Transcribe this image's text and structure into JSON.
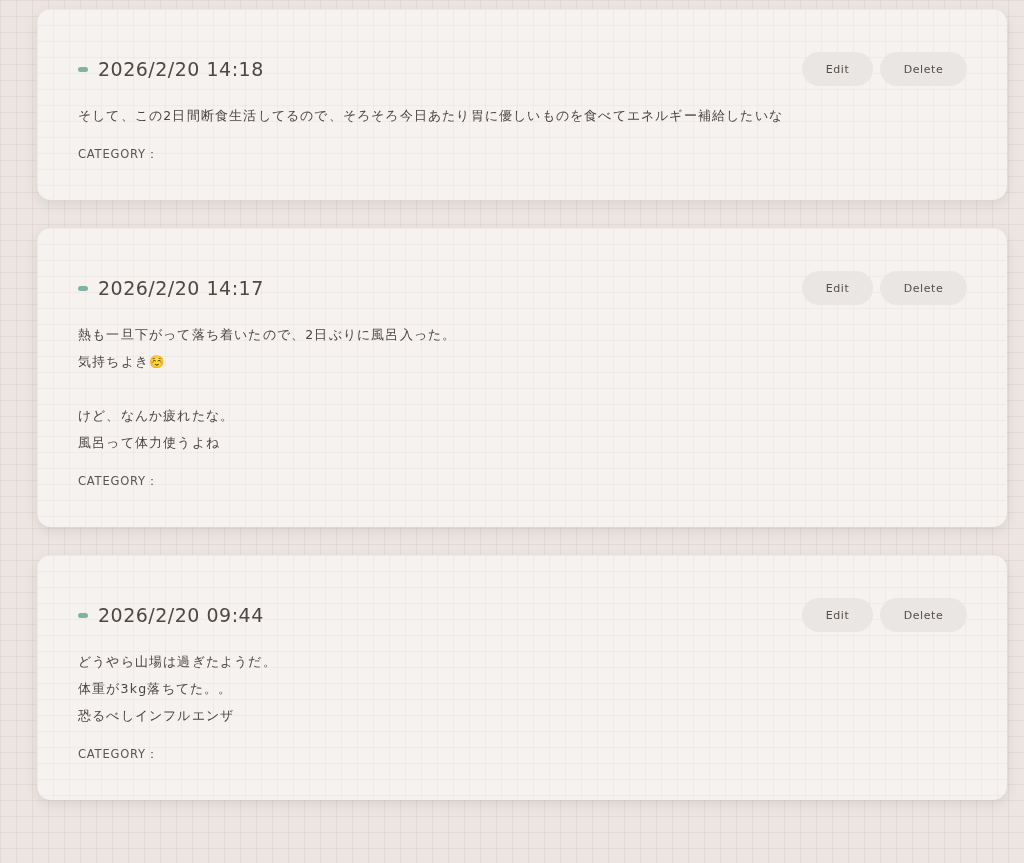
{
  "entries": [
    {
      "timestamp": "2026/2/20 14:18",
      "buttons": [
        "Edit",
        "Delete"
      ],
      "paragraphs": [
        [
          "そして、この2日間断食生活してるので、そろそろ今日あたり胃に優しいものを食べてエネルギー補給したいな"
        ]
      ],
      "category_label": "CATEGORY："
    },
    {
      "timestamp": "2026/2/20 14:17",
      "buttons": [
        "Edit",
        "Delete"
      ],
      "paragraphs": [
        [
          "熱も一旦下がって落ち着いたので、2日ぶりに風呂入った。",
          "気持ちよき☺️"
        ],
        [
          "けど、なんか疲れたな。",
          "風呂って体力使うよね"
        ]
      ],
      "category_label": "CATEGORY："
    },
    {
      "timestamp": "2026/2/20 09:44",
      "buttons": [
        "Edit",
        "Delete"
      ],
      "paragraphs": [
        [
          "どうやら山場は過ぎたようだ。",
          "体重が3kg落ちてた。。",
          "恐るべしインフルエンザ"
        ]
      ],
      "category_label": "CATEGORY："
    }
  ]
}
